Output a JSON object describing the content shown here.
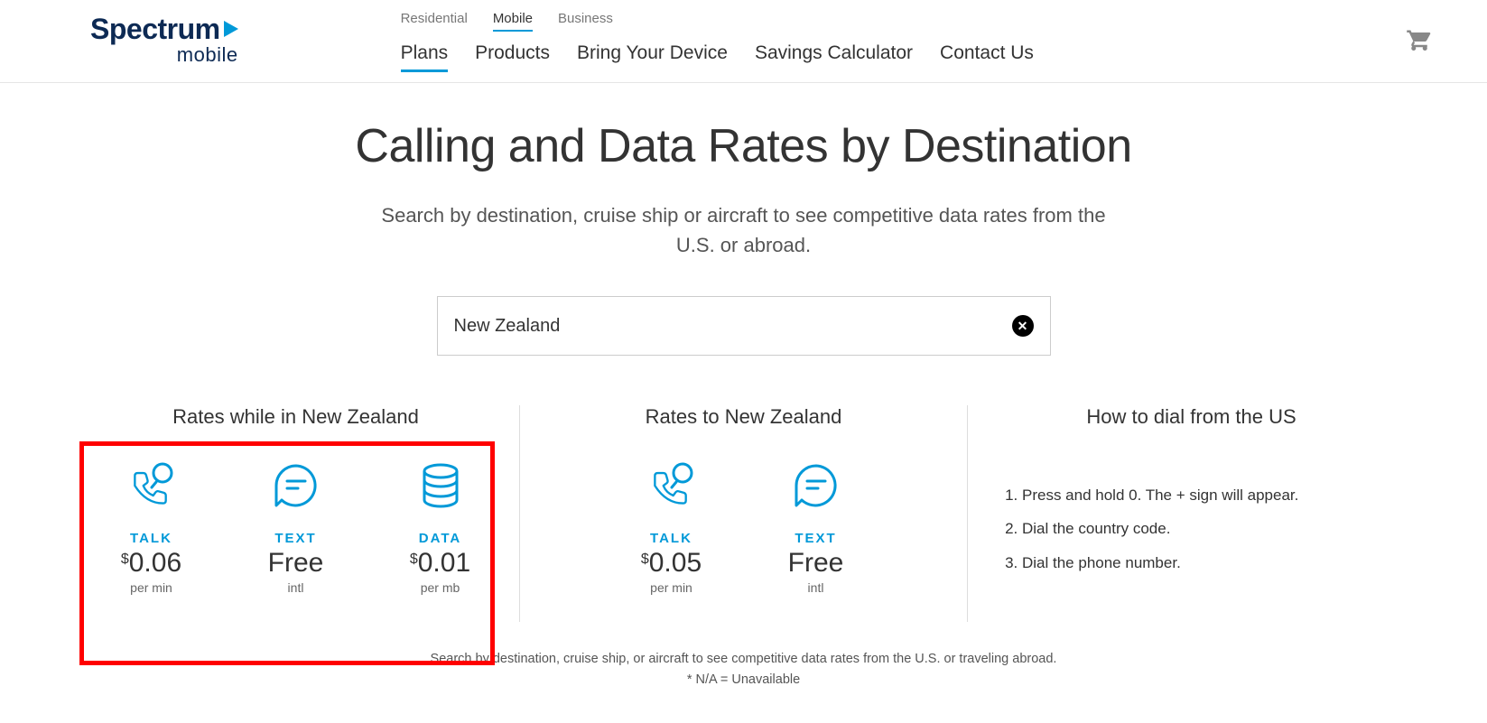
{
  "logo": {
    "name": "Spectrum",
    "sub": "mobile"
  },
  "topNav": [
    {
      "label": "Residential",
      "active": false
    },
    {
      "label": "Mobile",
      "active": true
    },
    {
      "label": "Business",
      "active": false
    }
  ],
  "mainNav": [
    {
      "label": "Plans",
      "active": true
    },
    {
      "label": "Products",
      "active": false
    },
    {
      "label": "Bring Your Device",
      "active": false
    },
    {
      "label": "Savings Calculator",
      "active": false
    },
    {
      "label": "Contact Us",
      "active": false
    }
  ],
  "hero": {
    "title": "Calling and Data Rates by Destination",
    "sub": "Search by destination, cruise ship or aircraft to see competitive data rates from the U.S. or abroad."
  },
  "search": {
    "value": "New Zealand",
    "placeholder": "Search destination"
  },
  "col1": {
    "title": "Rates while in New Zealand",
    "items": [
      {
        "icon": "talk",
        "label": "TALK",
        "currency": "$",
        "price": "0.06",
        "unit": "per min"
      },
      {
        "icon": "text",
        "label": "TEXT",
        "currency": "",
        "price": "Free",
        "unit": "intl"
      },
      {
        "icon": "data",
        "label": "DATA",
        "currency": "$",
        "price": "0.01",
        "unit": "per mb"
      }
    ]
  },
  "col2": {
    "title": "Rates to New Zealand",
    "items": [
      {
        "icon": "talk",
        "label": "TALK",
        "currency": "$",
        "price": "0.05",
        "unit": "per min"
      },
      {
        "icon": "text",
        "label": "TEXT",
        "currency": "",
        "price": "Free",
        "unit": "intl"
      }
    ]
  },
  "col3": {
    "title": "How to dial from the US",
    "steps": [
      "Press and hold 0. The + sign will appear.",
      "Dial the country code.",
      "Dial the phone number."
    ]
  },
  "footer": {
    "line1": "Search by destination, cruise ship, or aircraft to see competitive data rates from the U.S. or traveling abroad.",
    "line2": "* N/A = Unavailable"
  }
}
